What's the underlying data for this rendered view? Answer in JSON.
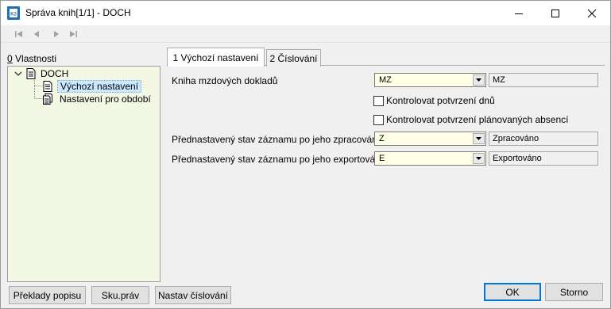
{
  "window": {
    "title": "Správa knih[1/1] - DOCH"
  },
  "toolbar": {
    "nav": [
      "first-record-icon",
      "previous-record-icon",
      "next-record-icon",
      "last-record-icon"
    ]
  },
  "left_panel": {
    "label_mnemonic": "0",
    "label_rest": " Vlastnosti",
    "tree": {
      "root": "DOCH",
      "children": [
        "Výchozí nastavení",
        "Nastavení pro období"
      ]
    }
  },
  "tabs": [
    {
      "label": "1 Výchozí nastavení",
      "active": true
    },
    {
      "label": "2 Číslování",
      "active": false
    }
  ],
  "form": {
    "kniha_label": "Kniha mzdových dokladů",
    "kniha_value": "MZ",
    "kniha_desc": "MZ",
    "chk1_label": "Kontrolovat potvrzení dnů",
    "chk1_checked": false,
    "chk2_label": "Kontrolovat potvrzení plánovaných absencí",
    "chk2_checked": false,
    "stav_zprac_label": "Přednastavený stav záznamu po jeho zpracování",
    "stav_zprac_value": "Z",
    "stav_zprac_desc": "Zpracováno",
    "stav_export_label": "Přednastavený stav záznamu po jeho exportová...",
    "stav_export_value": "E",
    "stav_export_desc": "Exportováno"
  },
  "buttons": {
    "preklady": "Překlady popisu",
    "sku_prav": "Sku.práv",
    "nastav_cislovani": "Nastav číslování",
    "ok": "OK",
    "storno": "Storno"
  },
  "colors": {
    "tree_bg": "#f2f8e4",
    "combo_bg": "#ffffe6",
    "selection": "#cce8ff",
    "default_button_border": "#0078d7"
  }
}
